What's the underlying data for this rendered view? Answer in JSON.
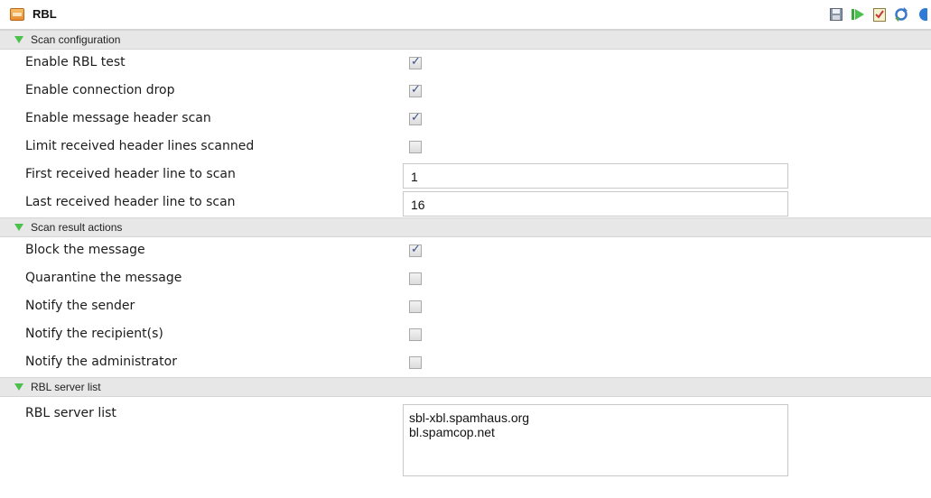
{
  "header": {
    "title": "RBL",
    "icon": "rbl-app-icon",
    "tools": [
      "save-icon",
      "run-icon",
      "checklist-icon",
      "refresh-icon",
      "help-icon"
    ]
  },
  "sections": {
    "scan_config": {
      "label": "Scan configuration",
      "rows": [
        {
          "label": "Enable RBL test",
          "checked": true
        },
        {
          "label": "Enable connection drop",
          "checked": true
        },
        {
          "label": "Enable message header scan",
          "checked": true
        },
        {
          "label": "Limit received header lines scanned",
          "checked": false
        }
      ],
      "first_line": {
        "label": "First received header line to scan",
        "value": "1"
      },
      "last_line": {
        "label": "Last received header line to scan",
        "value": "16"
      }
    },
    "scan_actions": {
      "label": "Scan result actions",
      "rows": [
        {
          "label": "Block the message",
          "checked": true
        },
        {
          "label": "Quarantine the message",
          "checked": false
        },
        {
          "label": "Notify the sender",
          "checked": false
        },
        {
          "label": "Notify the recipient(s)",
          "checked": false
        },
        {
          "label": "Notify the administrator",
          "checked": false
        }
      ]
    },
    "server_list": {
      "label": "RBL server list",
      "row_label": "RBL server list",
      "servers": "sbl-xbl.spamhaus.org\nbl.spamcop.net"
    }
  }
}
